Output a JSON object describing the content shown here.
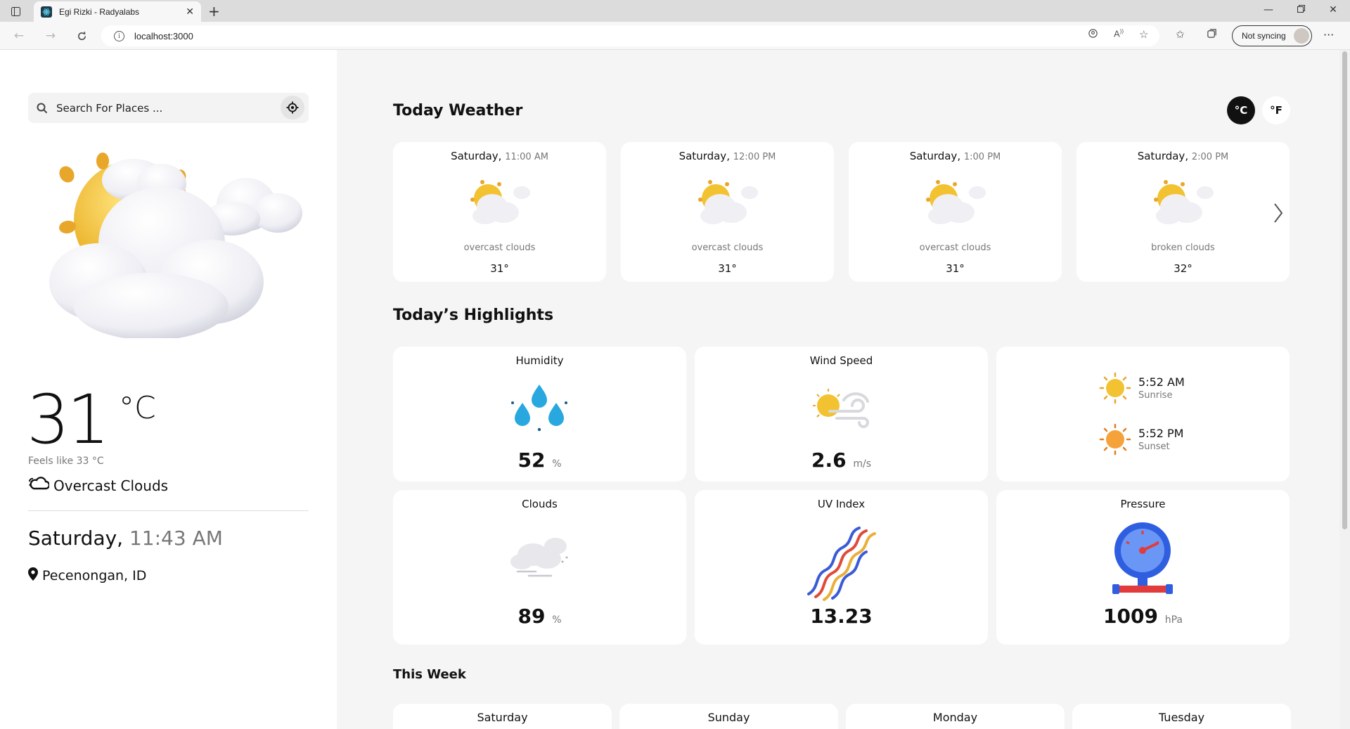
{
  "browser": {
    "tab_title": "Egi Rizki - Radyalabs",
    "url": "localhost:3000",
    "sync_label": "Not syncing"
  },
  "sidebar": {
    "search_placeholder": "Search For Places ...",
    "temperature": "31",
    "temp_unit": "°C",
    "feels_like": "Feels like 33 °C",
    "condition": "Overcast Clouds",
    "day": "Saturday,",
    "time": "11:43 AM",
    "location": "Pecenongan, ID"
  },
  "main": {
    "today_title": "Today Weather",
    "unit_c": "°C",
    "unit_f": "°F",
    "hourly": [
      {
        "day": "Saturday,",
        "time": "11:00 AM",
        "desc": "overcast clouds",
        "temp": "31°"
      },
      {
        "day": "Saturday,",
        "time": "12:00 PM",
        "desc": "overcast clouds",
        "temp": "31°"
      },
      {
        "day": "Saturday,",
        "time": "1:00 PM",
        "desc": "overcast clouds",
        "temp": "31°"
      },
      {
        "day": "Saturday,",
        "time": "2:00 PM",
        "desc": "broken clouds",
        "temp": "32°"
      }
    ],
    "highlights_title": "Today’s Highlights",
    "highlights": {
      "humidity": {
        "title": "Humidity",
        "value": "52",
        "unit": "%"
      },
      "wind": {
        "title": "Wind Speed",
        "value": "2.6",
        "unit": "m/s"
      },
      "sunrise": {
        "time": "5:52 AM",
        "label": "Sunrise"
      },
      "sunset": {
        "time": "5:52 PM",
        "label": "Sunset"
      },
      "clouds": {
        "title": "Clouds",
        "value": "89",
        "unit": "%"
      },
      "uv": {
        "title": "UV Index",
        "value": "13.23"
      },
      "pressure": {
        "title": "Pressure",
        "value": "1009",
        "unit": "hPa"
      }
    },
    "week_title": "This Week",
    "week_days": [
      "Saturday",
      "Sunday",
      "Monday",
      "Tuesday"
    ]
  },
  "colors": {
    "accent_dark": "#111111",
    "sun_yellow": "#f2c230",
    "drop_blue": "#29a8e0"
  }
}
